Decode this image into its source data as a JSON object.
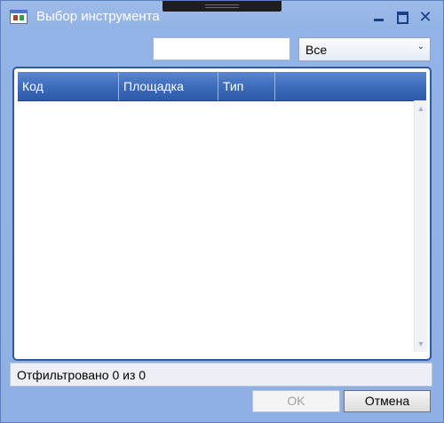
{
  "window": {
    "title": "Выбор инструмента",
    "icon": "app-window-icon",
    "controls": {
      "minimize_icon": "minimize-icon",
      "maximize_icon": "maximize-icon",
      "close_icon": "close-icon"
    }
  },
  "filter": {
    "search_value": "",
    "search_placeholder": "",
    "type_selected": "Все",
    "type_arrow": "⌄"
  },
  "grid": {
    "columns": [
      "Код",
      "Площадка",
      "Тип"
    ],
    "rows": [],
    "scroll_up": "▲",
    "scroll_down": "▼"
  },
  "status": {
    "text": "Отфильтровано 0 из 0"
  },
  "buttons": {
    "ok_label": "OK",
    "ok_enabled": false,
    "cancel_label": "Отмена"
  },
  "colors": {
    "window_background": "#93b3e6",
    "header_gradient_top": "#5b87cf",
    "header_gradient_bottom": "#2c5aa8",
    "grid_border": "#2b5aa8"
  }
}
